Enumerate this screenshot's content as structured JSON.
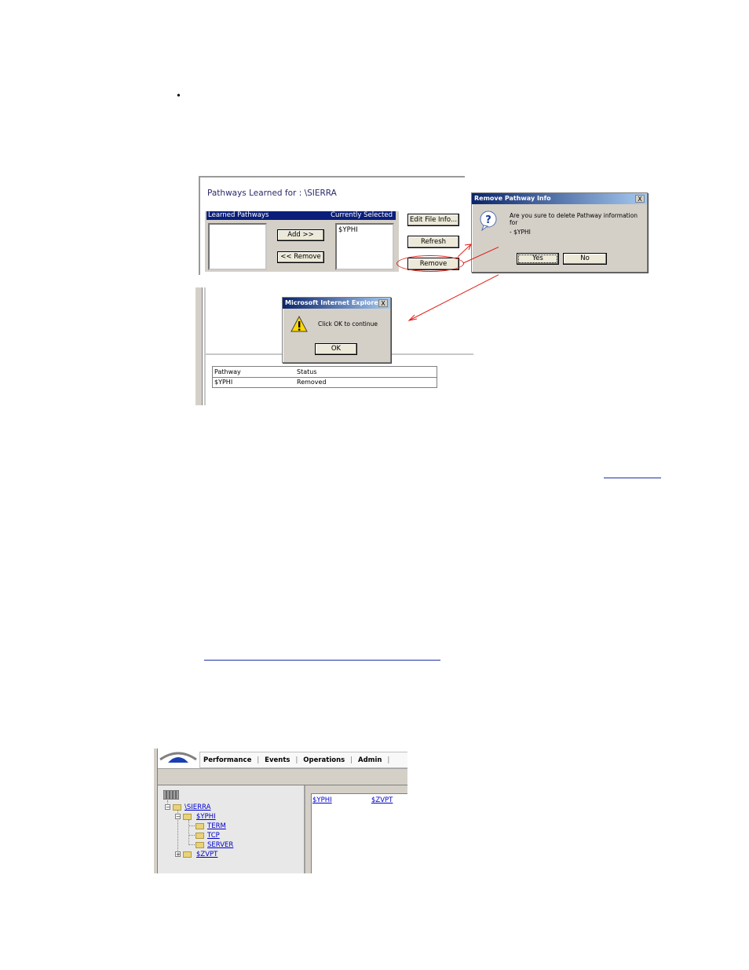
{
  "bullet": "•",
  "shot1": {
    "panel_title": "Pathways Learned for : \\SIERRA",
    "learned_header": "Learned Pathways",
    "selected_header": "Currently Selected",
    "selected_items": [
      "$YPHI"
    ],
    "add_button": "Add >>",
    "remove_left_button": "<< Remove",
    "edit_file_info_button": "Edit File Info...",
    "refresh_button": "Refresh",
    "remove_button": "Remove"
  },
  "remove_dialog": {
    "title": "Remove Pathway Info",
    "close": "X",
    "message": "Are you sure to delete Pathway information for",
    "item": "- $YPHI",
    "yes_button": "Yes",
    "no_button": "No"
  },
  "ie_dialog": {
    "title": "Microsoft Internet Explorer",
    "close": "X",
    "message": "Click OK to continue",
    "ok_button": "OK"
  },
  "result_table": {
    "headers": [
      "Pathway",
      "Status"
    ],
    "rows": [
      [
        "$YPHI",
        "Removed"
      ]
    ]
  },
  "shot3": {
    "menu": [
      "Performance",
      "Events",
      "Operations",
      "Admin"
    ],
    "tree": {
      "root": "\\SIERRA",
      "pathway1": "$YPHI",
      "children": [
        "TERM",
        "TCP",
        "SERVER"
      ],
      "pathway2": "$ZVPT"
    },
    "right_links": [
      "$YPHI",
      "$ZVPT"
    ]
  },
  "colors": {
    "header_blue": "#0a1e7a",
    "link_blue": "#0000cc",
    "annotation_red": "#e0201a",
    "dialog_gray": "#d4d0c8"
  }
}
